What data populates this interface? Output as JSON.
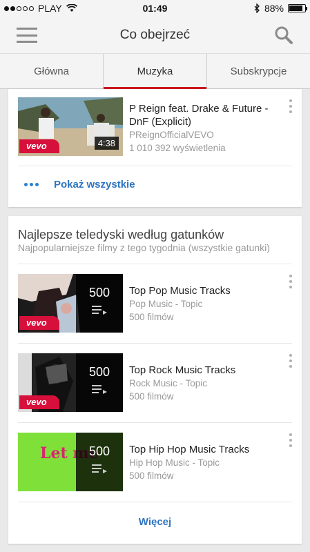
{
  "status_bar": {
    "carrier": "PLAY",
    "time": "01:49",
    "battery": "88%",
    "battery_level": 0.88
  },
  "header": {
    "title": "Co obejrzeć"
  },
  "tabs": [
    {
      "label": "Główna",
      "active": false
    },
    {
      "label": "Muzyka",
      "active": true
    },
    {
      "label": "Subskrypcje",
      "active": false
    }
  ],
  "video_card": {
    "video": {
      "title": "P Reign feat. Drake & Future - DnF (Explicit)",
      "channel": "PReignOfficialVEVO",
      "views": "1 010 392 wyświetlenia",
      "duration": "4:38",
      "badge": "vevo"
    },
    "show_all_label": "Pokaż wszystkie"
  },
  "genres_card": {
    "title": "Najlepsze teledyski według gatunków",
    "subtitle": "Najpopularniejsze filmy z tego tygodnia (wszystkie gatunki)",
    "playlists": [
      {
        "title": "Top Pop Music Tracks",
        "channel": "Pop Music - Topic",
        "count_text": "500 filmów",
        "count": "500",
        "badge": "vevo"
      },
      {
        "title": "Top Rock Music Tracks",
        "channel": "Rock Music - Topic",
        "count_text": "500 filmów",
        "count": "500",
        "badge": "vevo"
      },
      {
        "title": "Top Hip Hop Music Tracks",
        "channel": "Hip Hop Music - Topic",
        "count_text": "500 filmów",
        "count": "500",
        "thumb_text": "Let me"
      }
    ],
    "more_label": "Więcej"
  },
  "colors": {
    "accent_red": "#cc181e",
    "link_blue": "#2e74c0",
    "vevo_red": "#d7103b"
  }
}
